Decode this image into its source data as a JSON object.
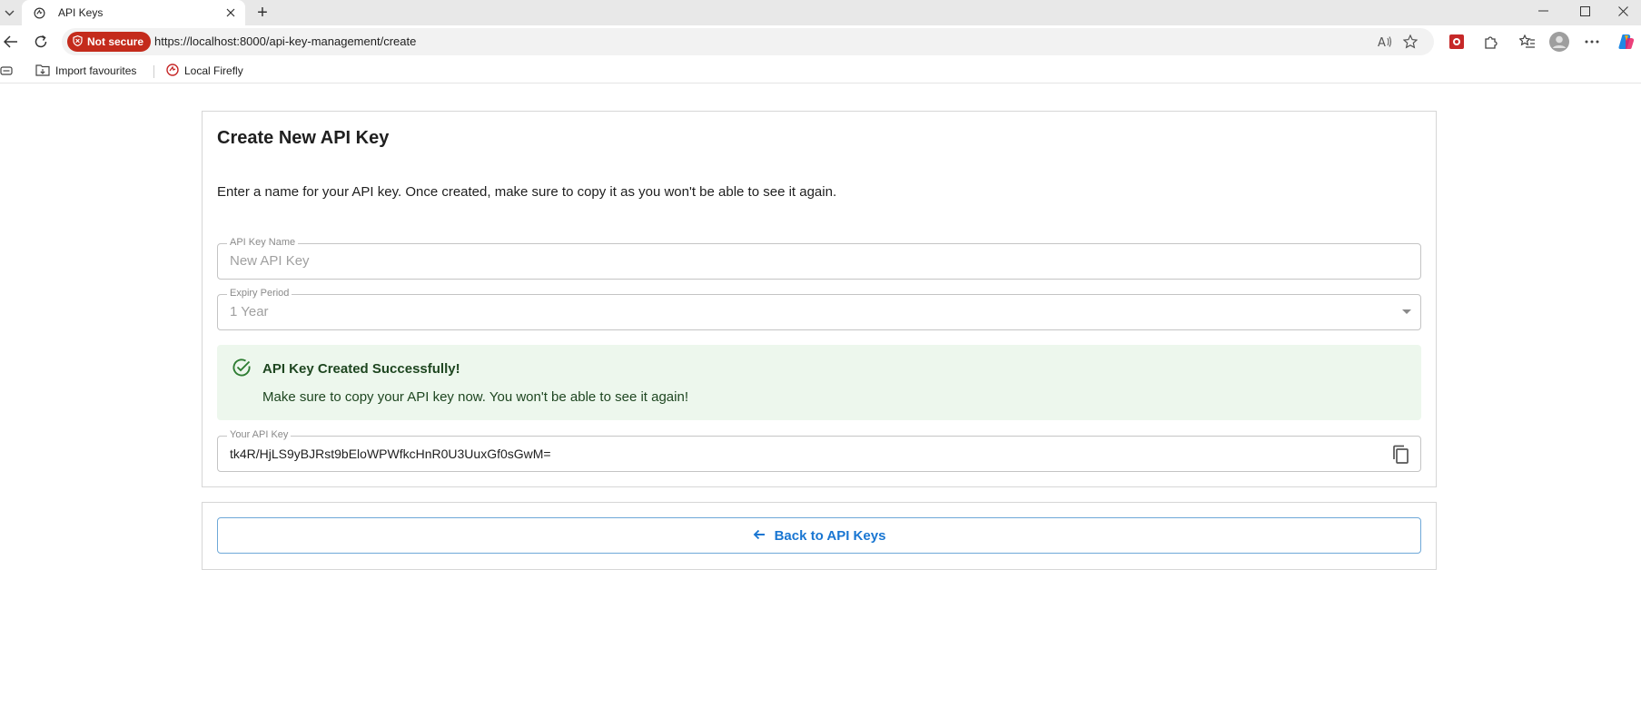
{
  "browser": {
    "tab_title": "API Keys",
    "new_tab_symbol": "+",
    "not_secure_label": "Not secure",
    "url": "https://localhost:8000/api-key-management/create",
    "bookmarks": [
      {
        "label": "Import favourites"
      },
      {
        "label": "Local Firefly"
      }
    ]
  },
  "page": {
    "title": "Create New API Key",
    "intro": "Enter a name for your API key. Once created, make sure to copy it as you won't be able to see it again.",
    "name_field": {
      "label": "API Key Name",
      "value": "New API Key"
    },
    "expiry_field": {
      "label": "Expiry Period",
      "value": "1 Year"
    },
    "alert": {
      "title": "API Key Created Successfully!",
      "body": "Make sure to copy your API key now. You won't be able to see it again!",
      "color": "#2e7d32"
    },
    "key_field": {
      "label": "Your API Key",
      "value": "tk4R/HjLS9yBJRst9bEloWPWfkcHnR0U3UuxGf0sGwM="
    },
    "back_button": {
      "label": "Back to API Keys",
      "color": "#1976d2"
    }
  }
}
